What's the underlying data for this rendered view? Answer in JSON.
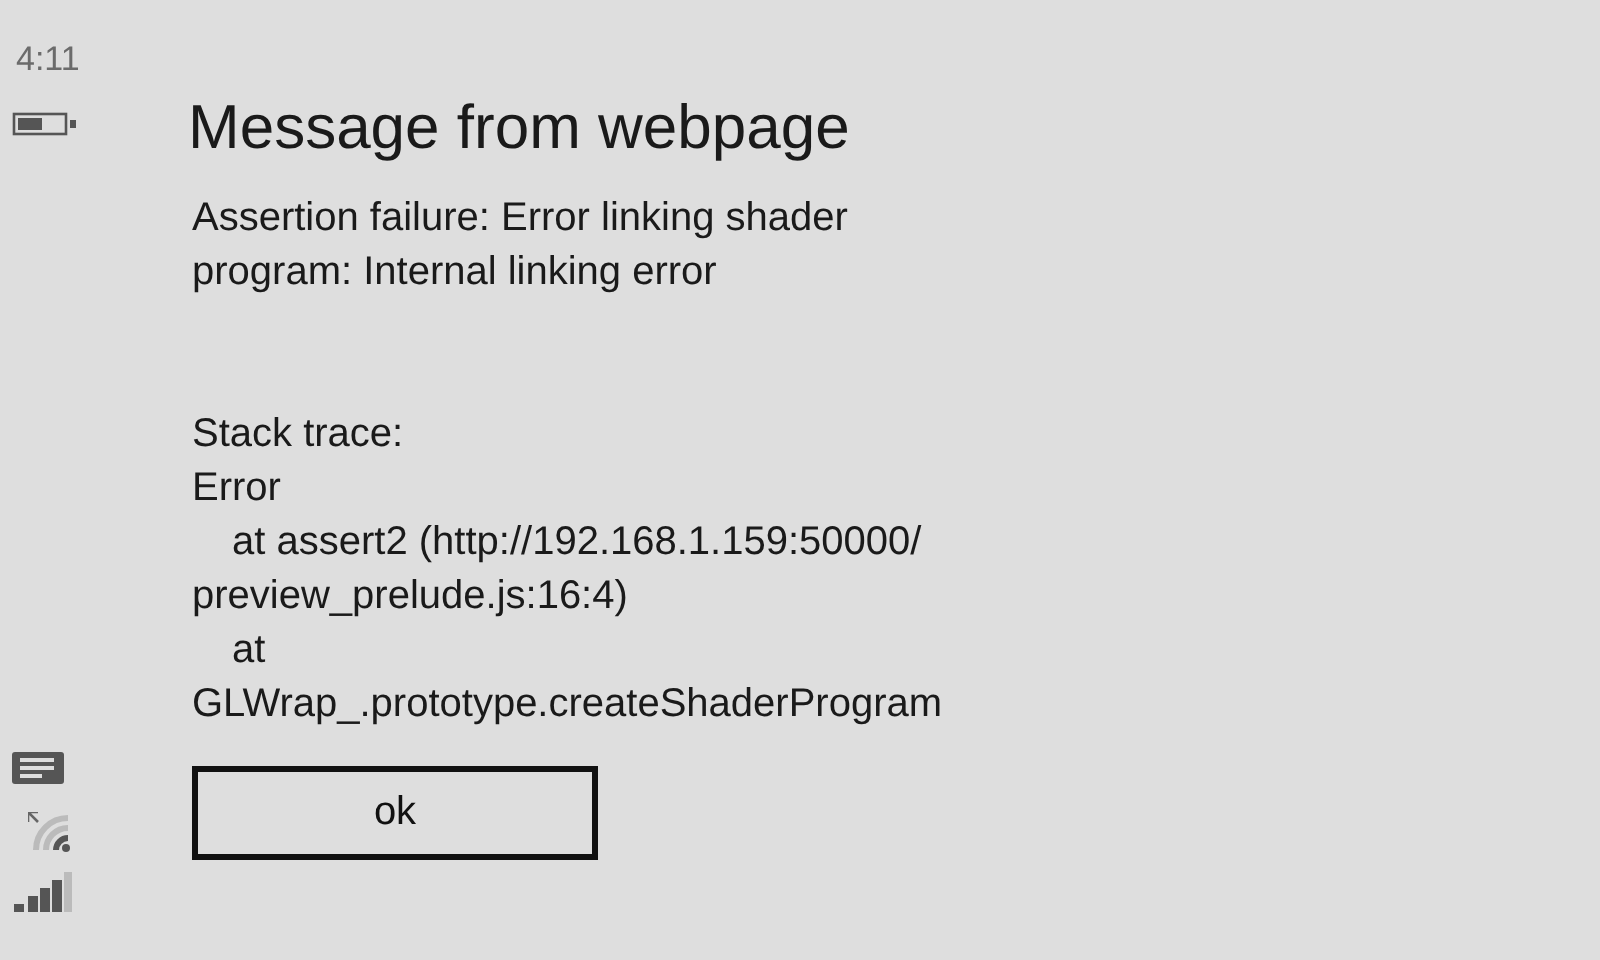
{
  "status_bar": {
    "time": "4:11"
  },
  "dialog": {
    "title": "Message from webpage",
    "message": [
      {
        "text": "Assertion failure: Error linking shader",
        "indent": false
      },
      {
        "text": "program: Internal linking error",
        "indent": false
      }
    ],
    "stack": [
      {
        "text": "Stack trace:",
        "indent": false
      },
      {
        "text": "Error",
        "indent": false
      },
      {
        "text": "at assert2 (http://192.168.1.159:50000/",
        "indent": true
      },
      {
        "text": "preview_prelude.js:16:4)",
        "indent": false
      },
      {
        "text": "at",
        "indent": true
      },
      {
        "text": "GLWrap_.prototype.createShaderProgram",
        "indent": false
      }
    ],
    "buttons": [
      "ok"
    ]
  }
}
